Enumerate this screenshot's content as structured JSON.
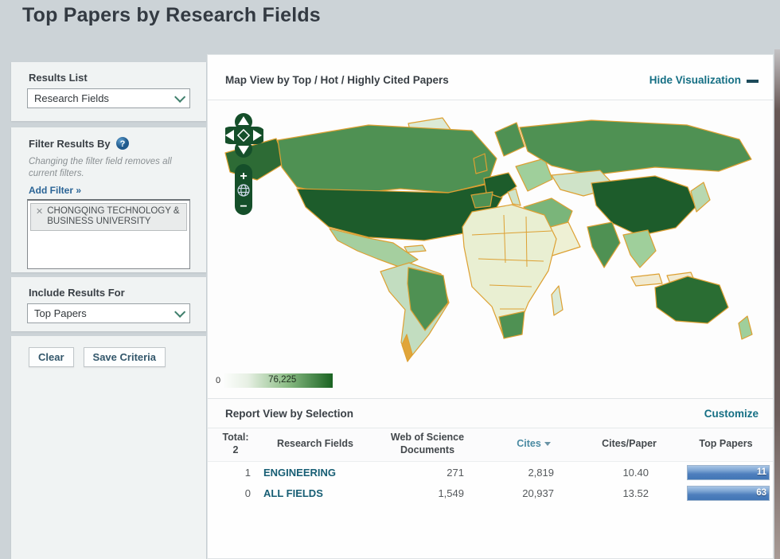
{
  "page": {
    "title": "Top Papers by Research Fields"
  },
  "sidebar": {
    "results_list": {
      "label": "Results List",
      "dropdown_value": "Research Fields"
    },
    "filter": {
      "label": "Filter Results By",
      "help_icon": "question-mark-icon",
      "note": "Changing the filter field removes all current filters.",
      "add_filter_label": "Add Filter »",
      "chip": {
        "remove_glyph": "✕",
        "text": "CHONGQING TECHNOLOGY & BUSINESS UNIVERSITY"
      }
    },
    "include": {
      "label": "Include Results For",
      "dropdown_value": "Top Papers"
    },
    "actions": {
      "clear_label": "Clear",
      "save_label": "Save Criteria"
    }
  },
  "visualization": {
    "title": "Map View by Top / Hot / Highly Cited Papers",
    "hide_label": "Hide Visualization",
    "legend": {
      "min": "0",
      "max": "76,225"
    },
    "controls": {
      "zoom_in": "+",
      "zoom_out": "−",
      "globe": "globe-icon",
      "pan": "pan-arrows-icon"
    }
  },
  "report": {
    "title": "Report View by Selection",
    "customize_label": "Customize",
    "total_label": "Total:",
    "total_value": "2",
    "columns": {
      "field": "Research Fields",
      "wos_line1": "Web of Science",
      "wos_line2": "Documents",
      "cites": "Cites",
      "cites_per_paper": "Cites/Paper",
      "top_papers": "Top Papers"
    },
    "rows": [
      {
        "rank": "1",
        "field": "ENGINEERING",
        "wos_documents": "271",
        "cites": "2,819",
        "cites_per_paper": "10.40",
        "top_papers": "11"
      },
      {
        "rank": "0",
        "field": "ALL FIELDS",
        "wos_documents": "1,549",
        "cites": "20,937",
        "cites_per_paper": "13.52",
        "top_papers": "63"
      }
    ]
  },
  "colors": {
    "teal_link": "#156f84",
    "field_link": "#175e74",
    "map_dark_green": "#1d5c2b",
    "map_medium_green": "#4f9153",
    "map_light_green": "#9fcf9b",
    "map_border_orange": "#dda032",
    "bar_blue": "#4e7fbd"
  }
}
